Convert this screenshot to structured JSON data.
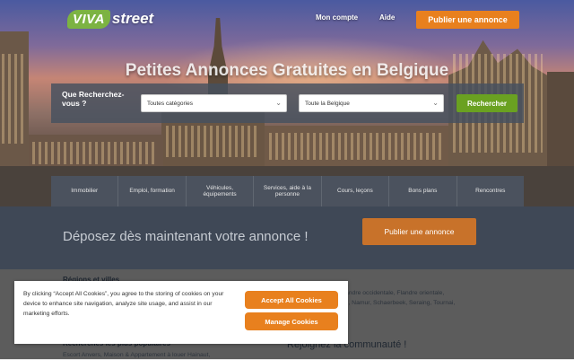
{
  "header": {
    "logo_badge": "VIVA",
    "logo_word": "street",
    "nav_account": "Mon compte",
    "nav_help": "Aide",
    "publish_button": "Publier une annonce"
  },
  "hero": {
    "headline": "Petites Annonces Gratuites en Belgique"
  },
  "search": {
    "question": "Que Recherchez-vous ?",
    "category_select": "Toutes catégories",
    "location_select": "Toute la Belgique",
    "search_button": "Rechercher"
  },
  "categories": [
    "Immobilier",
    "Emploi, formation",
    "Véhicules, équipements",
    "Services, aide à la personne",
    "Cours, leçons",
    "Bons plans",
    "Rencontres"
  ],
  "deposit": {
    "text": "Déposez dès maintenant votre annonce !",
    "button": "Publier une annonce"
  },
  "regions": {
    "title": "Régions et villes",
    "line1": "rai, Flandre occidentale, Flandre orientale,",
    "line2": "uscron, Namur, Schaerbeek, Seraing, Tournai,"
  },
  "popular": {
    "title": "Recherches les plus populaires",
    "text": "Escort Anvers, Maison & Appartement à louer Hainaut,"
  },
  "community": {
    "title": "Rejoignez la communauté !"
  },
  "cookie_banner": {
    "text": "By clicking “Accept All Cookies”, you agree to the storing of cookies on your device to enhance site navigation, analyze site usage, and assist in our marketing efforts.",
    "accept_button": "Accept All Cookies",
    "manage_button": "Manage Cookies"
  },
  "colors": {
    "accent_orange": "#e8801e",
    "search_green": "#6aa121",
    "logo_green": "#7cb342",
    "dark_band": "#3f4856"
  }
}
